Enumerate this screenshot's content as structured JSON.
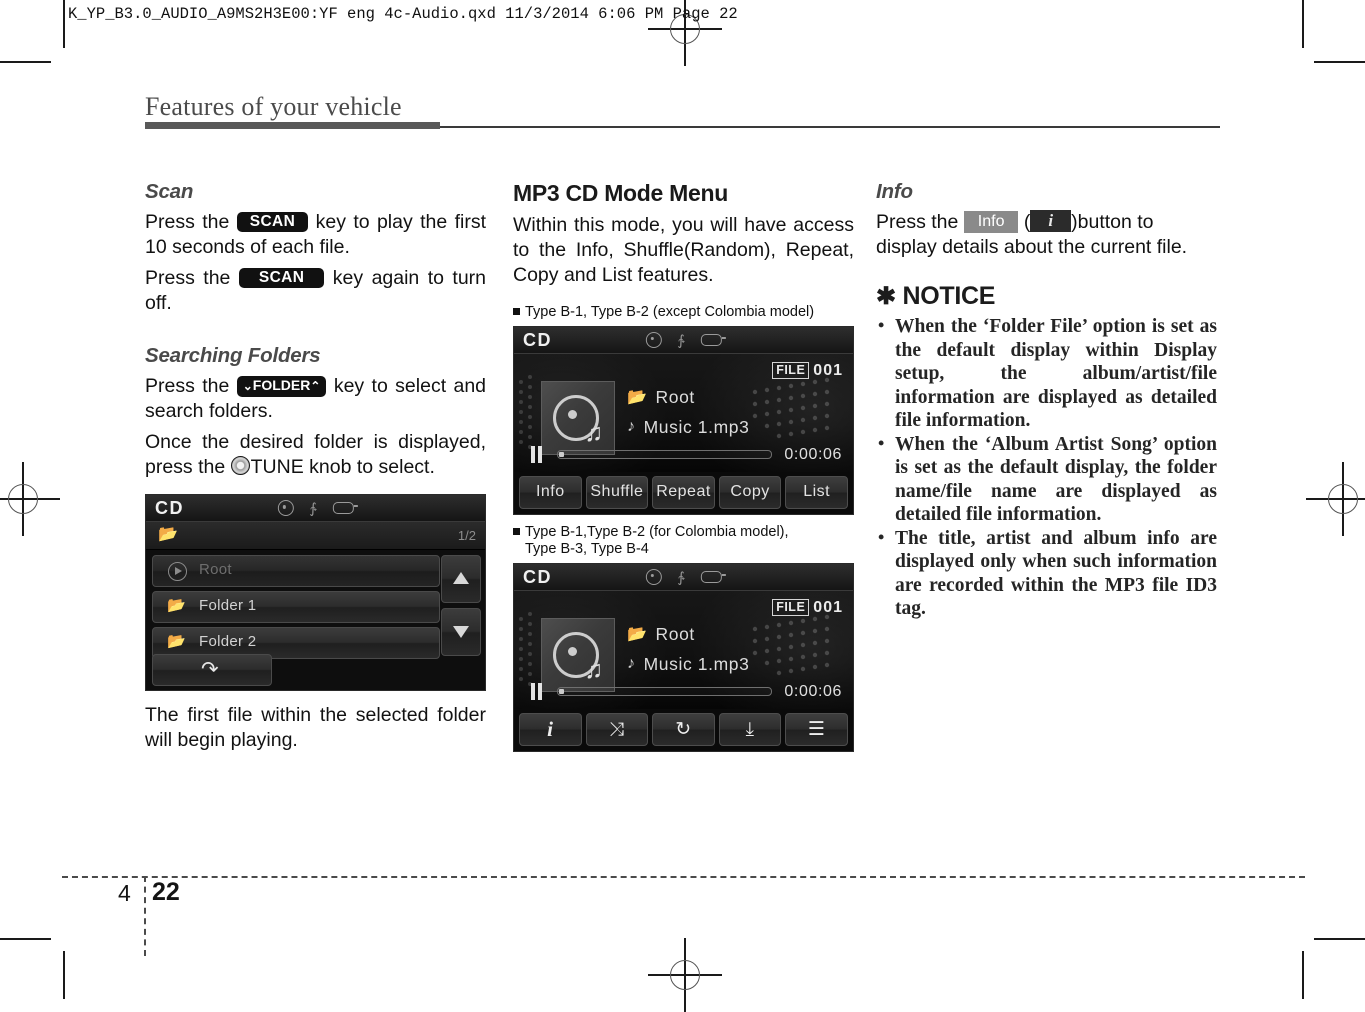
{
  "print_slug": "K_YP_B3.0_AUDIO_A9MS2H3E00:YF eng 4c-Audio.qxd  11/3/2014  6:06 PM  Page 22",
  "chapter_title": "Features of your vehicle",
  "footer": {
    "chapter_number": "4",
    "page_number": "22"
  },
  "column1": {
    "scan": {
      "heading": "Scan",
      "p1_a": "Press the",
      "p1_key": "SCAN",
      "p1_b": "key to play the first 10 seconds of each file.",
      "p2_a": "Press the",
      "p2_key": "SCAN",
      "p2_b": "key again to turn off."
    },
    "searching_folders": {
      "heading": "Searching Folders",
      "p1_a": "Press the",
      "p1_key": "FOLDER",
      "p1_key_down": "⌄",
      "p1_key_up": "⌃",
      "p1_b": "key to select and search folders.",
      "p2_a": "Once the desired folder is displayed, press the",
      "p2_knob": "TUNE",
      "p2_b": "knob to select.",
      "p3": "The first file within the selected folder will begin playing."
    },
    "folder_screen": {
      "source_label": "CD",
      "page_indicator": "1/2",
      "rows": [
        {
          "label": "Root",
          "icon": "play-icon",
          "dim": true
        },
        {
          "label": "Folder 1",
          "icon": "folder-icon",
          "dim": false
        },
        {
          "label": "Folder 2",
          "icon": "folder-icon",
          "dim": false
        }
      ],
      "scroll_up": "▲",
      "scroll_down": "▼",
      "back_icon": "return-arrow-icon"
    }
  },
  "column2": {
    "heading": "MP3 CD Mode Menu",
    "intro": "Within this mode, you will have access to the Info, Shuffle(Random), Repeat, Copy and List features.",
    "caption1": "Type B-1, Type B-2 (except Colombia model)",
    "caption2_line1": "Type B-1,Type B-2 (for Colombia model),",
    "caption2_line2": "Type B-3, Type B-4",
    "player_a": {
      "source_label": "CD",
      "file_badge": "FILE",
      "file_number": "001",
      "folder_name": "Root",
      "track_name": "Music 1.mp3",
      "elapsed_time": "0:00:06",
      "buttons": [
        {
          "label": "Info",
          "name": "info"
        },
        {
          "label": "Shuffle",
          "name": "shuffle"
        },
        {
          "label": "Repeat",
          "name": "repeat"
        },
        {
          "label": "Copy",
          "name": "copy"
        },
        {
          "label": "List",
          "name": "list"
        }
      ]
    },
    "player_b": {
      "source_label": "CD",
      "file_badge": "FILE",
      "file_number": "001",
      "folder_name": "Root",
      "track_name": "Music 1.mp3",
      "elapsed_time": "0:00:06",
      "buttons": [
        {
          "glyph": "i",
          "name": "info"
        },
        {
          "glyph": "⤨",
          "name": "shuffle"
        },
        {
          "glyph": "↻",
          "name": "repeat"
        },
        {
          "glyph": "⤓",
          "name": "copy"
        },
        {
          "glyph": "☰",
          "name": "list"
        }
      ]
    }
  },
  "column3": {
    "info": {
      "heading": "Info",
      "p1_a": "Press the",
      "p1_key": "Info",
      "p1_paren_open": "(",
      "p1_key_icon": "i",
      "p1_paren_close": ")button to display details about the current file."
    },
    "notice": {
      "star": "✱",
      "heading": "NOTICE",
      "items": [
        "When the ‘Folder File’ option is set as the default display within Display setup, the album/artist/file information are displayed as detailed file information.",
        "When the ‘Album Artist Song’ option is set as the default display, the folder name/file name are displayed as detailed file information.",
        "The title, artist and album info are displayed only when such information are recorded within the MP3 file ID3 tag."
      ]
    }
  }
}
